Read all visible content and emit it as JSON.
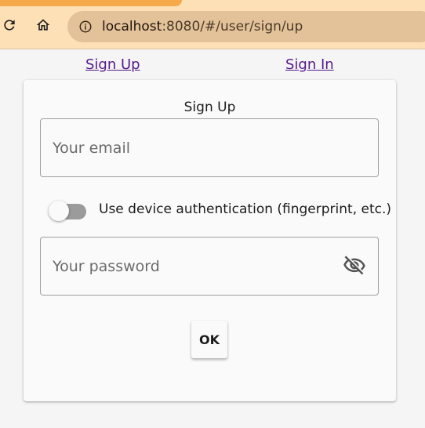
{
  "browser": {
    "url_host": "localhost",
    "url_rest": ":8080/#/user/sign/up",
    "reload_icon": "reload-icon",
    "home_icon": "home-icon",
    "info_icon": "info-icon"
  },
  "nav": {
    "sign_up": "Sign Up",
    "sign_in": "Sign In"
  },
  "form": {
    "title": "Sign Up",
    "email_placeholder": "Your email",
    "switch_label": "Use device authentication (fingerprint, etc.)",
    "switch_on": false,
    "password_placeholder": "Your password",
    "visibility_icon": "visibility-off-icon",
    "ok_label": "OK"
  },
  "colors": {
    "link": "#551a8b",
    "chrome": "#fde0b6",
    "urlbar": "#e3c29a"
  }
}
